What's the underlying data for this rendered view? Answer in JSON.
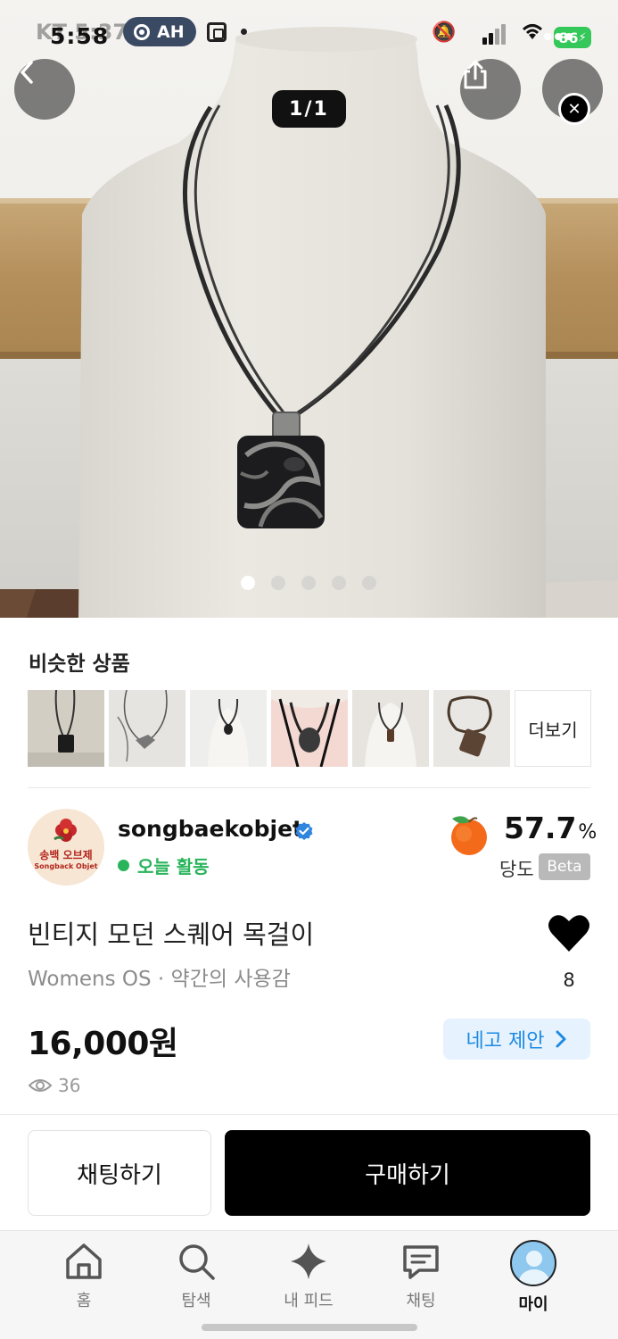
{
  "status_bar": {
    "carrier_time_ghost": "KT 5:37",
    "time": "5:58",
    "recording_label": "AH",
    "battery": "86"
  },
  "gallery": {
    "counter": "1/1",
    "dot_count": 5,
    "active_dot": 0
  },
  "similar": {
    "title": "비슷한 상품",
    "more_label": "더보기",
    "thumb_count": 6
  },
  "seller": {
    "avatar_text_kr": "송백 오브제",
    "avatar_text_en": "Songback Objet",
    "name": "songbaekobjet",
    "activity": "오늘 활동",
    "temperature_value": "57.7",
    "temperature_unit": "%",
    "temperature_label": "당도",
    "beta": "Beta"
  },
  "product": {
    "title": "빈티지 모던 스퀘어 목걸이",
    "meta": "Womens OS · 약간의 사용감",
    "like_count": "8",
    "price": "16,000원",
    "offer_label": "네고 제안",
    "views": "36"
  },
  "actions": {
    "chat": "채팅하기",
    "buy": "구매하기"
  },
  "tabs": [
    {
      "label": "홈",
      "icon": "home-icon"
    },
    {
      "label": "탐색",
      "icon": "search-icon"
    },
    {
      "label": "내 피드",
      "icon": "sparkle-icon"
    },
    {
      "label": "채팅",
      "icon": "chat-icon"
    },
    {
      "label": "마이",
      "icon": "profile-avatar"
    }
  ],
  "colors": {
    "active_green": "#28b45a",
    "offer_blue": "#1d8ae3",
    "offer_bg": "#e6f2fd",
    "buy_black": "#000000",
    "battery_green": "#34c759"
  }
}
